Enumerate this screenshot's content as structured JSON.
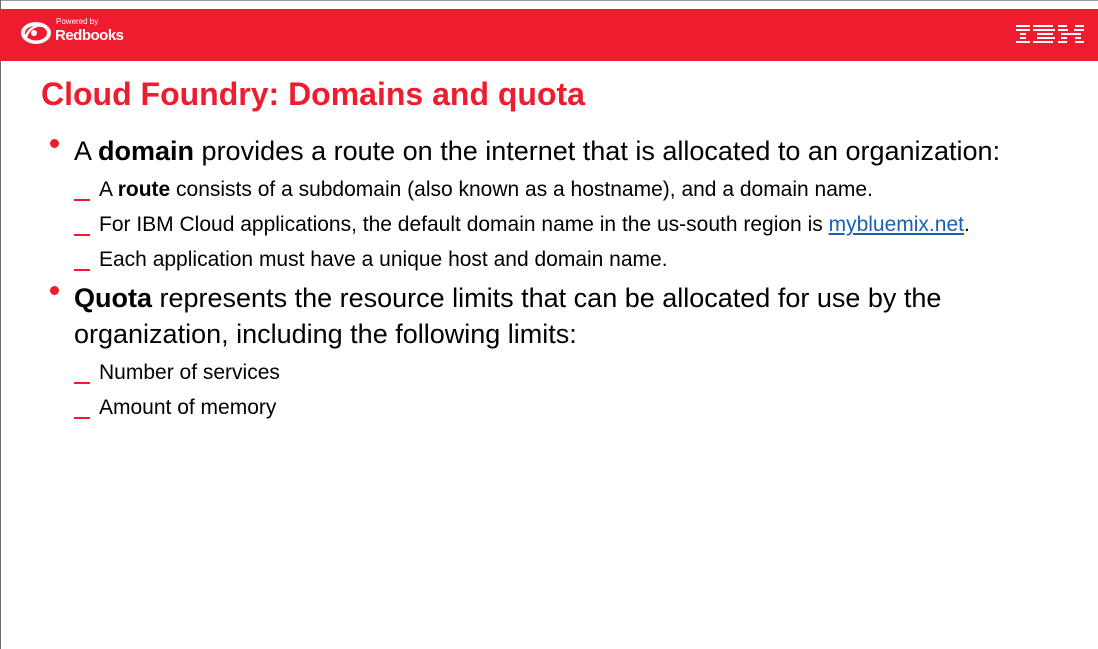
{
  "header": {
    "logo_powered_by": "Powered by",
    "logo_name": "Redbooks",
    "brand": "IBM"
  },
  "title": "Cloud Foundry: Domains and quota",
  "bullets": {
    "domain": {
      "pre": "A ",
      "bold": "domain",
      "rest": " provides a route on the internet that is allocated to an organization:",
      "subs": {
        "route": {
          "pre": "A ",
          "bold": "route",
          "rest": " consists of a subdomain (also known as a hostname), and a domain name."
        },
        "default_domain": {
          "pre": "For IBM Cloud applications, the default domain name in the us-south region is ",
          "link": "mybluemix.net",
          "post": "."
        },
        "unique": {
          "text": "Each application must have a unique host and domain name."
        }
      }
    },
    "quota": {
      "bold": "Quota",
      "rest": " represents the resource limits that can be allocated for use by the organization, including the following limits:",
      "subs": {
        "services": "Number of services",
        "memory": "Amount of memory"
      }
    }
  },
  "colors": {
    "accent_red": "#ee1c2e",
    "link_blue": "#1a5fb4"
  },
  "icons": {
    "logo": "redbooks-logo-icon",
    "brand": "ibm-logo-icon",
    "bullet": "bullet-dot-icon",
    "sub_bullet": "dash-icon"
  }
}
